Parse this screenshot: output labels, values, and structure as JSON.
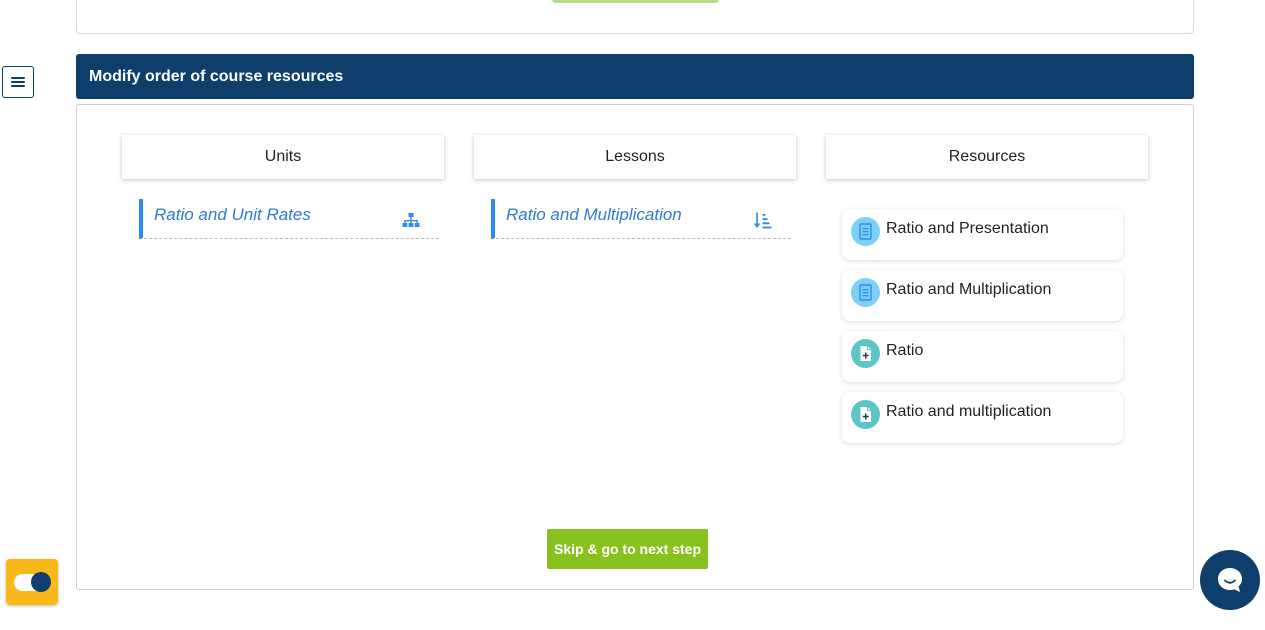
{
  "panel": {
    "title": "Modify order of course resources"
  },
  "columns": {
    "units": "Units",
    "lessons": "Lessons",
    "resources": "Resources"
  },
  "units": [
    {
      "label": "Ratio and Unit Rates",
      "icon": "sitemap-icon"
    }
  ],
  "lessons": [
    {
      "label": "Ratio and Multiplication",
      "icon": "sort-order-icon"
    }
  ],
  "resources": [
    {
      "label": "Ratio and Presentation",
      "icon": "document-icon"
    },
    {
      "label": "Ratio and Multiplication",
      "icon": "document-icon"
    },
    {
      "label": "Ratio",
      "icon": "add-file-icon"
    },
    {
      "label": "Ratio and multiplication",
      "icon": "add-file-icon"
    }
  ],
  "actions": {
    "skip_label": "Skip & go to next step"
  },
  "colors": {
    "header_bg": "#0d3e6c",
    "accent_blue": "#2e8cf0",
    "skip_green": "#87c21f",
    "toggle_yellow": "#fbb81b"
  }
}
